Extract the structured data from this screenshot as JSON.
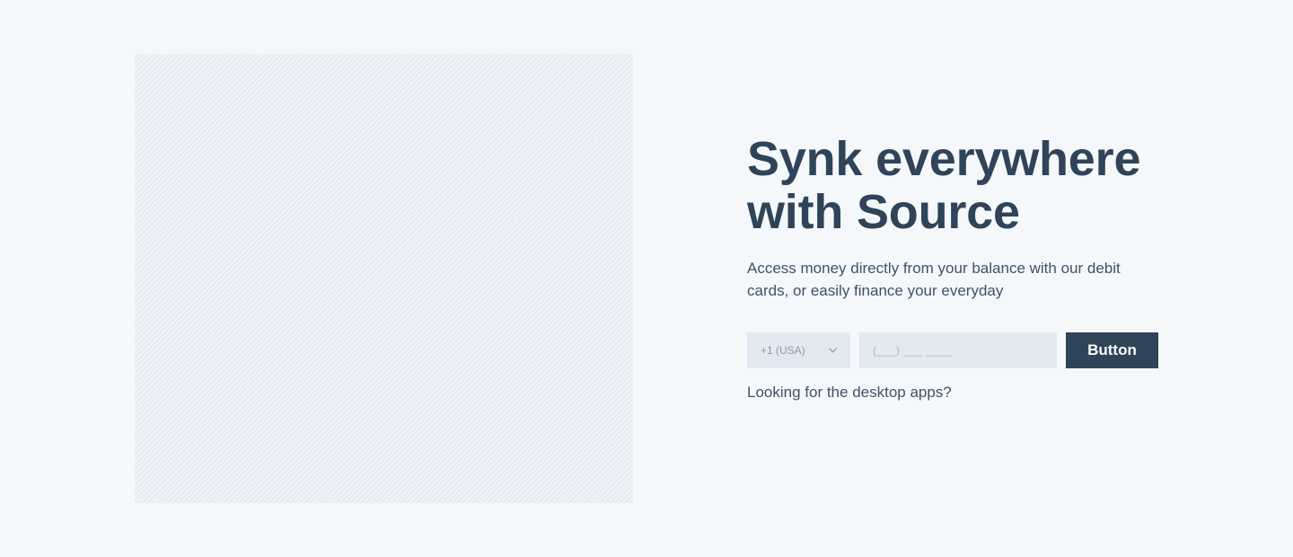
{
  "hero": {
    "title": "Synk everywhere with Source",
    "subtitle": "Access money directly from your balance with our debit cards, or easily finance your everyday",
    "country_select": {
      "selected": "+1 (USA)",
      "icon": "chevron-down-icon"
    },
    "phone_input": {
      "value": "",
      "placeholder": "(___) ___ ____"
    },
    "button_label": "Button",
    "desktop_link": "Looking for the desktop apps?"
  },
  "colors": {
    "background": "#f5f8fb",
    "heading": "#2f4459",
    "input_background": "#e3e9f0",
    "button_background": "#2f4459",
    "button_text": "#ffffff"
  }
}
